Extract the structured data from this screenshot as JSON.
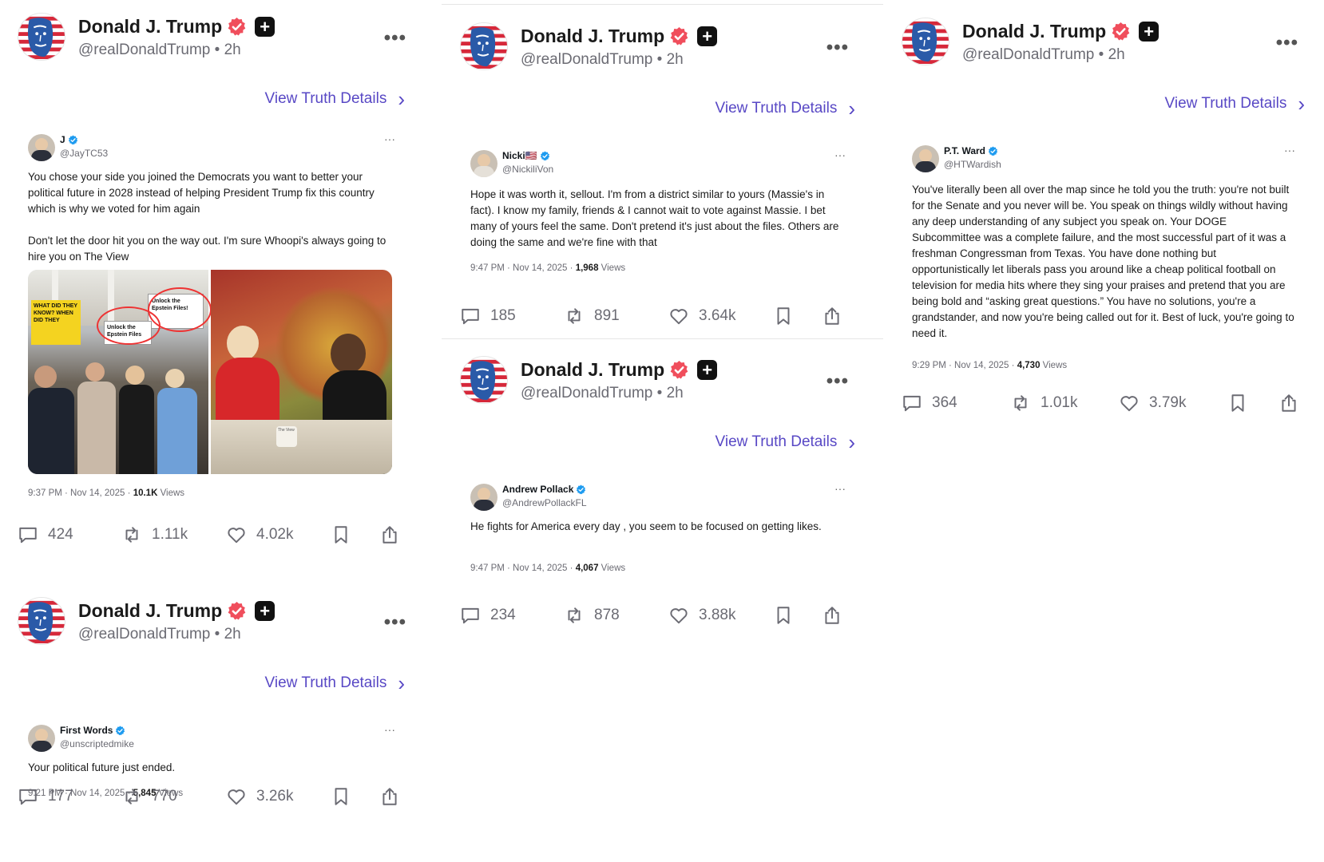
{
  "author": {
    "name": "Donald J. Trump",
    "handle": "@realDonaldTrump",
    "time": "• 2h",
    "more": "•••"
  },
  "view_details_label": "View Truth Details",
  "chevron": "›",
  "icons": [
    "donald-trump-avatar",
    "verified-badge-icon",
    "plus-badge-icon",
    "more-icon",
    "reply-icon",
    "retruth-icon",
    "like-icon",
    "bookmark-icon",
    "share-icon"
  ],
  "colors": {
    "link": "#5848c5",
    "verified": "#f04e5c",
    "x_verified": "#1d9bf0"
  },
  "posts": [
    {
      "quoted": {
        "name": "J",
        "handle": "@JayTC53",
        "text": [
          "You chose your side you joined the Democrats you want to better your political future in 2028 instead of helping President Trump fix this country which is why we voted for him again",
          "Don't let the door hit you on the way out. I'm sure Whoopi's always going to hire you on The View"
        ],
        "time": "9:37 PM · Nov 14, 2025 · ",
        "views": "10.1K",
        "views_label": " Views",
        "more": "···",
        "images": [
          {
            "signs": [
              "WHAT DID THEY KNOW? WHEN DID THEY",
              "Unlock the Epstein Files!",
              "Unlock the Epstein Files"
            ]
          },
          {
            "mug": "The View"
          }
        ]
      },
      "stats": {
        "replies": "424",
        "retruths": "1.11k",
        "likes": "4.02k"
      }
    },
    {
      "quoted": {
        "name": "First Words",
        "handle": "@unscriptedmike",
        "text": [
          "Your political future just ended."
        ],
        "time": "9:21 PM · Nov 14, 2025 · ",
        "views": "5,845",
        "views_label": " Views",
        "more": "···"
      },
      "stats": {
        "replies": "177",
        "retruths": "770",
        "likes": "3.26k"
      }
    },
    {
      "quoted": {
        "name": "Nicki🇺🇸",
        "handle": "@NickiliVon",
        "text": [
          "Hope it was worth it, sellout. I'm from a district similar to yours (Massie's in fact). I know my family, friends & I cannot wait to vote against Massie. I bet many of yours feel the same. Don't pretend it's just about the files. Others are doing the same and we're fine with that"
        ],
        "time": "9:47 PM · Nov 14, 2025 · ",
        "views": "1,968",
        "views_label": " Views",
        "more": "···"
      },
      "stats": {
        "replies": "185",
        "retruths": "891",
        "likes": "3.64k"
      }
    },
    {
      "quoted": {
        "name": "Andrew Pollack",
        "handle": "@AndrewPollackFL",
        "text": [
          "He fights for America every day , you seem to be focused on getting likes."
        ],
        "time": "9:47 PM · Nov 14, 2025 · ",
        "views": "4,067",
        "views_label": " Views",
        "more": "···"
      },
      "stats": {
        "replies": "234",
        "retruths": "878",
        "likes": "3.88k"
      }
    },
    {
      "quoted": {
        "name": "P.T. Ward",
        "handle": "@HTWardish",
        "text": [
          "You've literally been all over the map since he told you the truth: you're not built for the Senate and you never will be. You speak on things wildly without having any deep understanding of any subject you speak on. Your DOGE Subcommittee was a complete failure, and the most successful part of it was a freshman Congressman from Texas. You have done nothing but opportunistically let liberals pass you around like a cheap political football on television for media hits where they sing your praises and pretend that you are being bold and “asking great questions.” You have no solutions, you're a grandstander, and now you're being called out for it. Best of luck, you're going to need it."
        ],
        "time": "9:29 PM · Nov 14, 2025 · ",
        "views": "4,730",
        "views_label": " Views",
        "more": "···"
      },
      "stats": {
        "replies": "364",
        "retruths": "1.01k",
        "likes": "3.79k"
      }
    }
  ]
}
